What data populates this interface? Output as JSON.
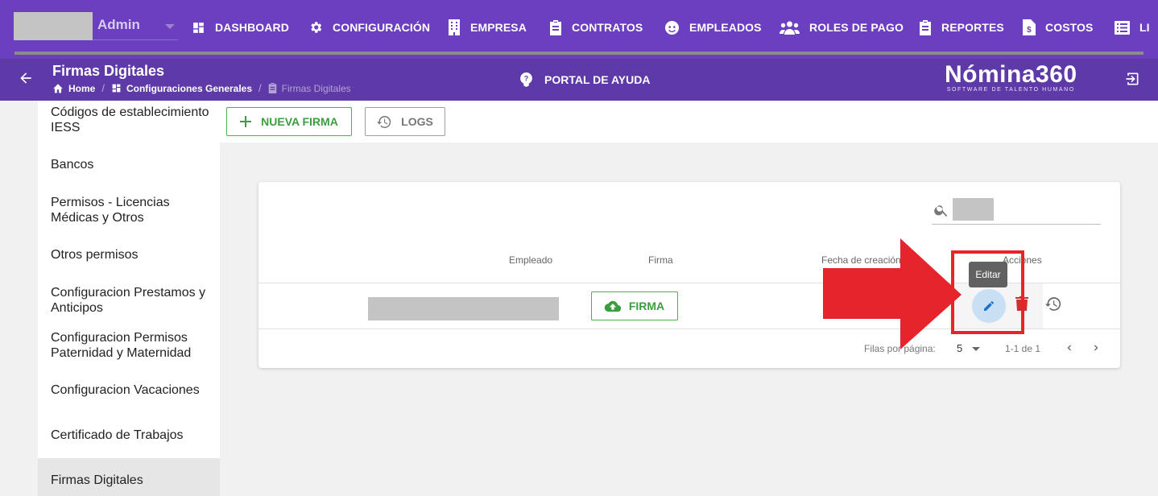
{
  "topbar": {
    "user_label": "Admin",
    "nav": [
      {
        "label": "DASHBOARD",
        "icon": "dashboard-icon"
      },
      {
        "label": "CONFIGURACIÓN",
        "icon": "gear-icon"
      },
      {
        "label": "EMPRESA",
        "icon": "building-icon"
      },
      {
        "label": "CONTRATOS",
        "icon": "clipboard-icon"
      },
      {
        "label": "EMPLEADOS",
        "icon": "face-icon"
      },
      {
        "label": "ROLES DE PAGO",
        "icon": "people-icon"
      },
      {
        "label": "REPORTES",
        "icon": "clipboard-icon"
      },
      {
        "label": "COSTOS",
        "icon": "dollar-file-icon"
      },
      {
        "label": "LI",
        "icon": "list-icon"
      }
    ]
  },
  "subbar": {
    "title": "Firmas Digitales",
    "breadcrumb": [
      "Home",
      "Configuraciones Generales",
      "Firmas Digitales"
    ],
    "help_label": "PORTAL DE AYUDA",
    "brand": "Nómina360",
    "brand_tagline": "SOFTWARE DE TALENTO HUMANO"
  },
  "sidebar": {
    "items": [
      "Códigos de establecimiento IESS",
      "Bancos",
      "Permisos - Licencias Médicas y Otros",
      "Otros permisos",
      "Configuracion Prestamos y Anticipos",
      "Configuracion Permisos Paternidad y Maternidad",
      "Configuracion Vacaciones",
      "Certificado de Trabajos",
      "Firmas Digitales"
    ],
    "active": "Firmas Digitales"
  },
  "toolbar": {
    "new_label": "NUEVA FIRMA",
    "logs_label": "LOGS"
  },
  "table": {
    "headers": [
      "Empleado",
      "Firma",
      "Fecha de creación",
      "Acciones"
    ],
    "rows": [
      {
        "empleado": "",
        "firma_label": "FIRMA"
      }
    ],
    "tooltip": "Editar",
    "footer": {
      "rows_per_page_label": "Filas por página:",
      "rows_per_page": "5",
      "range": "1-1 de 1"
    }
  },
  "colors": {
    "topbar": "#6b3fbf",
    "subbar": "#5e3aa8",
    "accent_green": "#4caf50",
    "annotation_red": "#e5242b"
  }
}
